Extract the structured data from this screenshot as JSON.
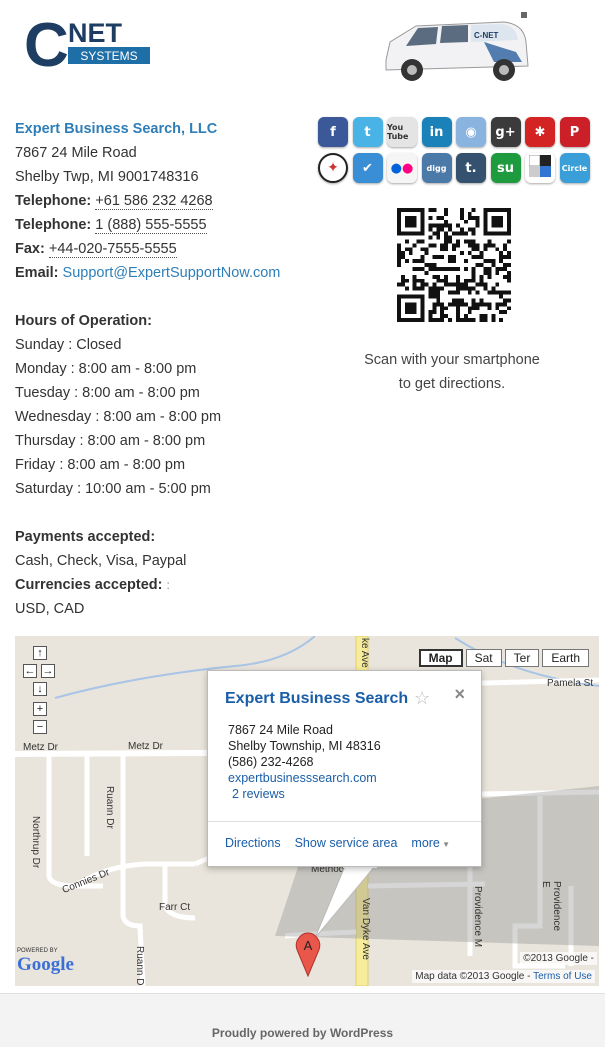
{
  "brand": {
    "logo_letter": "C",
    "logo_word": "NET",
    "logo_sub": "SYSTEMS",
    "van_logo": "C-NET"
  },
  "business": {
    "name": "Expert Business Search, LLC",
    "street": "7867 24 Mile Road",
    "city": "Shelby Twp, MI 9001748316",
    "telephone_label": "Telephone:",
    "telephone_1": "+61 586 232 4268",
    "telephone_2": "1 (888) 555-5555",
    "fax_label": "Fax:",
    "fax": "+44-020-7555-5555",
    "email_label": "Email:",
    "email": "Support@ExpertSupportNow.com"
  },
  "hours": {
    "title": "Hours of Operation:",
    "days": [
      "Sunday : Closed",
      "Monday : 8:00 am - 8:00 pm",
      "Tuesday : 8:00 am - 8:00 pm",
      "Wednesday : 8:00 am - 8:00 pm",
      "Thursday : 8:00 am - 8:00 pm",
      "Friday : 8:00 am - 8:00 pm",
      "Saturday : 10:00 am - 5:00 pm"
    ]
  },
  "payments": {
    "title": "Payments accepted:",
    "methods": "Cash, Check, Visa, Paypal",
    "currencies_title": "Currencies accepted:",
    "currencies_colon": ":",
    "currencies": "USD, CAD"
  },
  "social": [
    {
      "name": "facebook-icon",
      "glyph": "f",
      "color": "#3b5998"
    },
    {
      "name": "twitter-icon",
      "glyph": "t",
      "color": "#4ab3e6"
    },
    {
      "name": "youtube-icon",
      "glyph": "You Tube",
      "color": "#e4e4e4"
    },
    {
      "name": "linkedin-icon",
      "glyph": "in",
      "color": "#1b82b9"
    },
    {
      "name": "maps-icon",
      "glyph": "◉",
      "color": "#8ab4e0"
    },
    {
      "name": "google-plus-icon",
      "glyph": "g+",
      "color": "#3b3b3b"
    },
    {
      "name": "yelp-icon",
      "glyph": "✱",
      "color": "#d32323"
    },
    {
      "name": "pinterest-icon",
      "glyph": "P",
      "color": "#cb2027"
    },
    {
      "name": "frog-icon",
      "glyph": "🐸",
      "color": "#ffffff"
    },
    {
      "name": "foursquare-icon",
      "glyph": "✔",
      "color": "#3a8ed6"
    },
    {
      "name": "flickr-icon",
      "glyph": "●●",
      "color": "#f5f5f5"
    },
    {
      "name": "digg-icon",
      "glyph": "digg",
      "color": "#4c7aa8"
    },
    {
      "name": "tumblr-icon",
      "glyph": "t.",
      "color": "#34526f"
    },
    {
      "name": "stumbleupon-icon",
      "glyph": "su",
      "color": "#1f9b3f"
    },
    {
      "name": "delicious-icon",
      "glyph": "",
      "color": "#ffffff"
    },
    {
      "name": "circle-icon",
      "glyph": "Circle",
      "color": "#3a9fd8"
    }
  ],
  "qr": {
    "caption_1": "Scan with your smartphone",
    "caption_2": "to get directions."
  },
  "map": {
    "types": [
      "Map",
      "Sat",
      "Ter",
      "Earth"
    ],
    "active_type": "Map",
    "streets": {
      "pamela": "Pamela St",
      "metz_left": "Metz Dr",
      "metz_right": "Metz Dr",
      "northrup": "Northrup Dr",
      "ruann": "Ruann Dr",
      "ruann_bottom": "Ruann Dr",
      "connies": "Connies Dr",
      "farr": "Farr Ct",
      "methodist": "Methodist",
      "van_dyke": "Van Dyke Ave",
      "van_dyke_top": "ke Ave",
      "providence": "Providence M",
      "providence_e": "Providence E"
    },
    "popup": {
      "title": "Expert Business Search",
      "address_1": "7867 24 Mile Road",
      "address_2": "Shelby Township, MI 48316",
      "phone": "(586) 232-4268",
      "website": "expertbusinesssearch.com",
      "reviews": "2 reviews",
      "directions": "Directions",
      "service_area": "Show service area",
      "more": "more"
    },
    "marker_label": "A",
    "powered_by": "POWERED BY",
    "google": "Google",
    "copyright": "©2013 Google -",
    "map_data": "Map data ©2013 Google -",
    "terms": "Terms of Use"
  },
  "footer": {
    "text": "Proudly powered by WordPress"
  }
}
